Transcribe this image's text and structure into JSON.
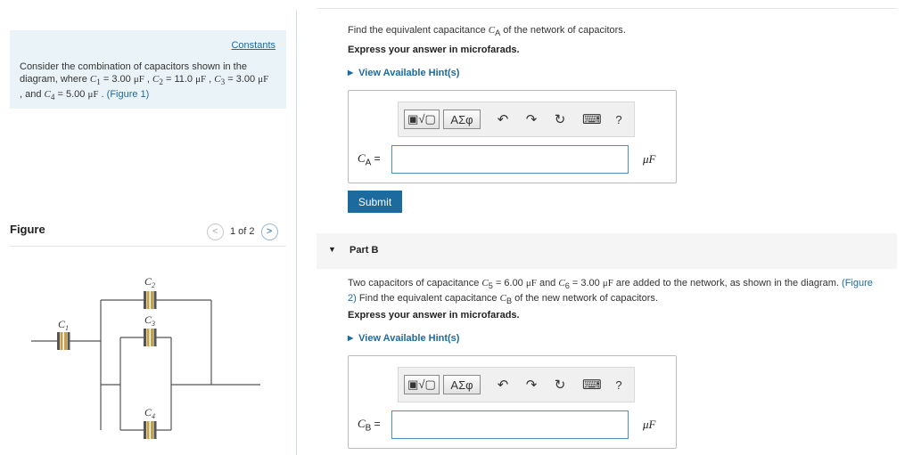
{
  "left": {
    "constants_link": "Constants",
    "intro_prefix": "Consider the combination of capacitors shown in the diagram, where ",
    "c1_sym": "C",
    "c1_sub": "1",
    "c1_val": " = 3.00 ",
    "c2_sym": "C",
    "c2_sub": "2",
    "c2_val": " = 11.0 ",
    "c3_sym": "C",
    "c3_sub": "3",
    "c3_val": " = 3.00 ",
    "and_text": " , and ",
    "c4_sym": "C",
    "c4_sub": "4",
    "c4_val": " = 5.00 ",
    "unit": "μF",
    "figure_link": "(Figure 1)",
    "figure_label": "Figure",
    "pager_text": "1 of 2",
    "pager_prev": "<",
    "pager_next": ">"
  },
  "circuit": {
    "labels": [
      "C1",
      "C2",
      "C3",
      "C4"
    ],
    "cap_color": "#c8a046",
    "wire_color": "#555555"
  },
  "part_a": {
    "prompt_prefix": "Find the equivalent capacitance ",
    "prompt_sym": "C",
    "prompt_sub": "A",
    "prompt_suffix": " of the network of capacitors.",
    "instruction": "Express your answer in microfarads.",
    "hint": "View Available Hint(s)",
    "answer_sym": "C",
    "answer_sub": "A",
    "answer_eq": " =",
    "answer_value": "",
    "unit": "μF",
    "submit": "Submit"
  },
  "toolbar": {
    "templates_label": "▣√▢",
    "greek_label": "ΑΣφ",
    "undo_icon": "↶",
    "redo_icon": "↷",
    "reset_icon": "↻",
    "keyboard_icon": "⌨",
    "help_icon": "?"
  },
  "part_b": {
    "arrow": "▼",
    "title": "Part B",
    "prompt_a": "Two capacitors of capacitance ",
    "c5_sym": "C",
    "c5_sub": "5",
    "c5_val": " = 6.00 ",
    "and": " and ",
    "c6_sym": "C",
    "c6_sub": "6",
    "c6_val": " = 3.00 ",
    "unit_inline": "μF",
    "prompt_b": " are added to the network, as shown in the diagram. ",
    "figure_link": "(Figure 2)",
    "prompt_c": " Find the equivalent capacitance ",
    "cb_sym": "C",
    "cb_sub": "B",
    "prompt_d": " of the new network of capacitors.",
    "instruction": "Express your answer in microfarads.",
    "hint": "View Available Hint(s)",
    "answer_sym": "C",
    "answer_sub": "B",
    "answer_eq": " =",
    "answer_value": "",
    "unit": "μF"
  }
}
